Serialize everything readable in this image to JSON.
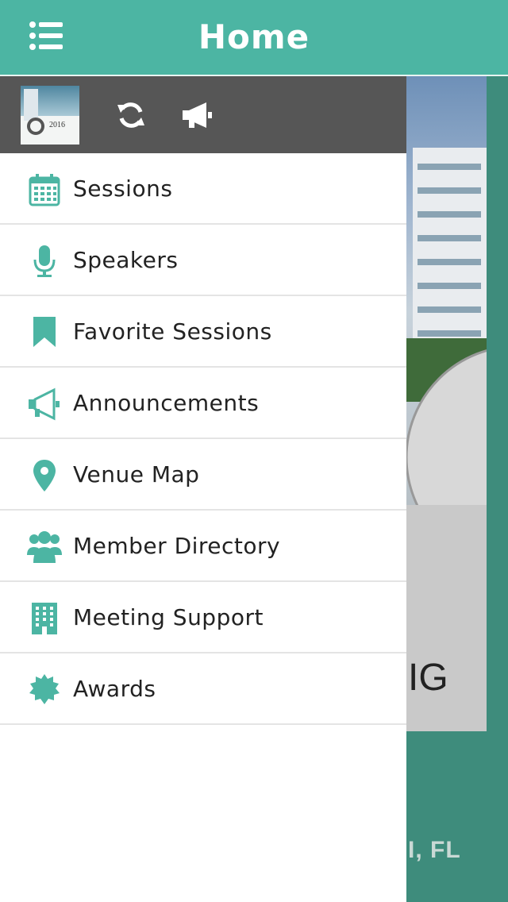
{
  "header": {
    "title": "Home",
    "menu_icon": "list-menu-icon"
  },
  "drawer": {
    "toolbar": {
      "logo_year": "2016",
      "refresh_icon": "refresh-icon",
      "announcements_icon": "megaphone-icon"
    },
    "items": [
      {
        "label": "Sessions",
        "icon": "calendar-icon"
      },
      {
        "label": "Speakers",
        "icon": "microphone-icon"
      },
      {
        "label": "Favorite Sessions",
        "icon": "bookmark-icon"
      },
      {
        "label": "Announcements",
        "icon": "megaphone-icon"
      },
      {
        "label": "Venue Map",
        "icon": "map-pin-icon"
      },
      {
        "label": "Member Directory",
        "icon": "people-icon"
      },
      {
        "label": "Meeting Support",
        "icon": "building-icon"
      },
      {
        "label": "Awards",
        "icon": "award-badge-icon"
      }
    ]
  },
  "background_page": {
    "card_text": "IG",
    "footer_text": "I, FL"
  },
  "colors": {
    "accent": "#4cb5a3",
    "drawer_header": "#565656",
    "icon": "#4cb5a3"
  }
}
